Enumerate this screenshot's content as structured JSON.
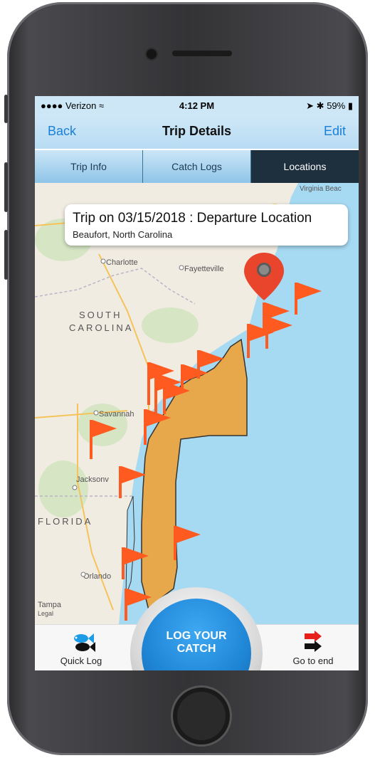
{
  "status_bar": {
    "carrier": "Verizon",
    "time": "4:12 PM",
    "battery": "59%"
  },
  "nav": {
    "back_label": "Back",
    "title": "Trip Details",
    "edit_label": "Edit"
  },
  "tabs": [
    {
      "label": "Trip Info",
      "active": false
    },
    {
      "label": "Catch Logs",
      "active": false
    },
    {
      "label": "Locations",
      "active": true
    }
  ],
  "map": {
    "callout": {
      "title": "Trip on 03/15/2018 : Departure Location",
      "subtitle": "Beaufort, North Carolina"
    },
    "labels": {
      "virginia_beach": "Virginia Beac",
      "charlotte": "Charlotte",
      "fayetteville": "Fayetteville",
      "south": "SOUTH",
      "carolina": "CAROLINA",
      "savannah": "Savannah",
      "jacksonville": "Jacksonv",
      "florida": "FLORIDA",
      "orlando": "Orlando",
      "tampa": "Tampa",
      "legal": "Legal"
    },
    "flag_color": "#ff5a1f",
    "pin_color": "#e8452c",
    "zone_color": "#e6a84b",
    "water_color": "#a6d9f2"
  },
  "bottom": {
    "quick_log_label": "Quick Log",
    "log_catch_line1": "LOG YOUR",
    "log_catch_line2": "CATCH",
    "go_to_end_label": "Go to end"
  }
}
